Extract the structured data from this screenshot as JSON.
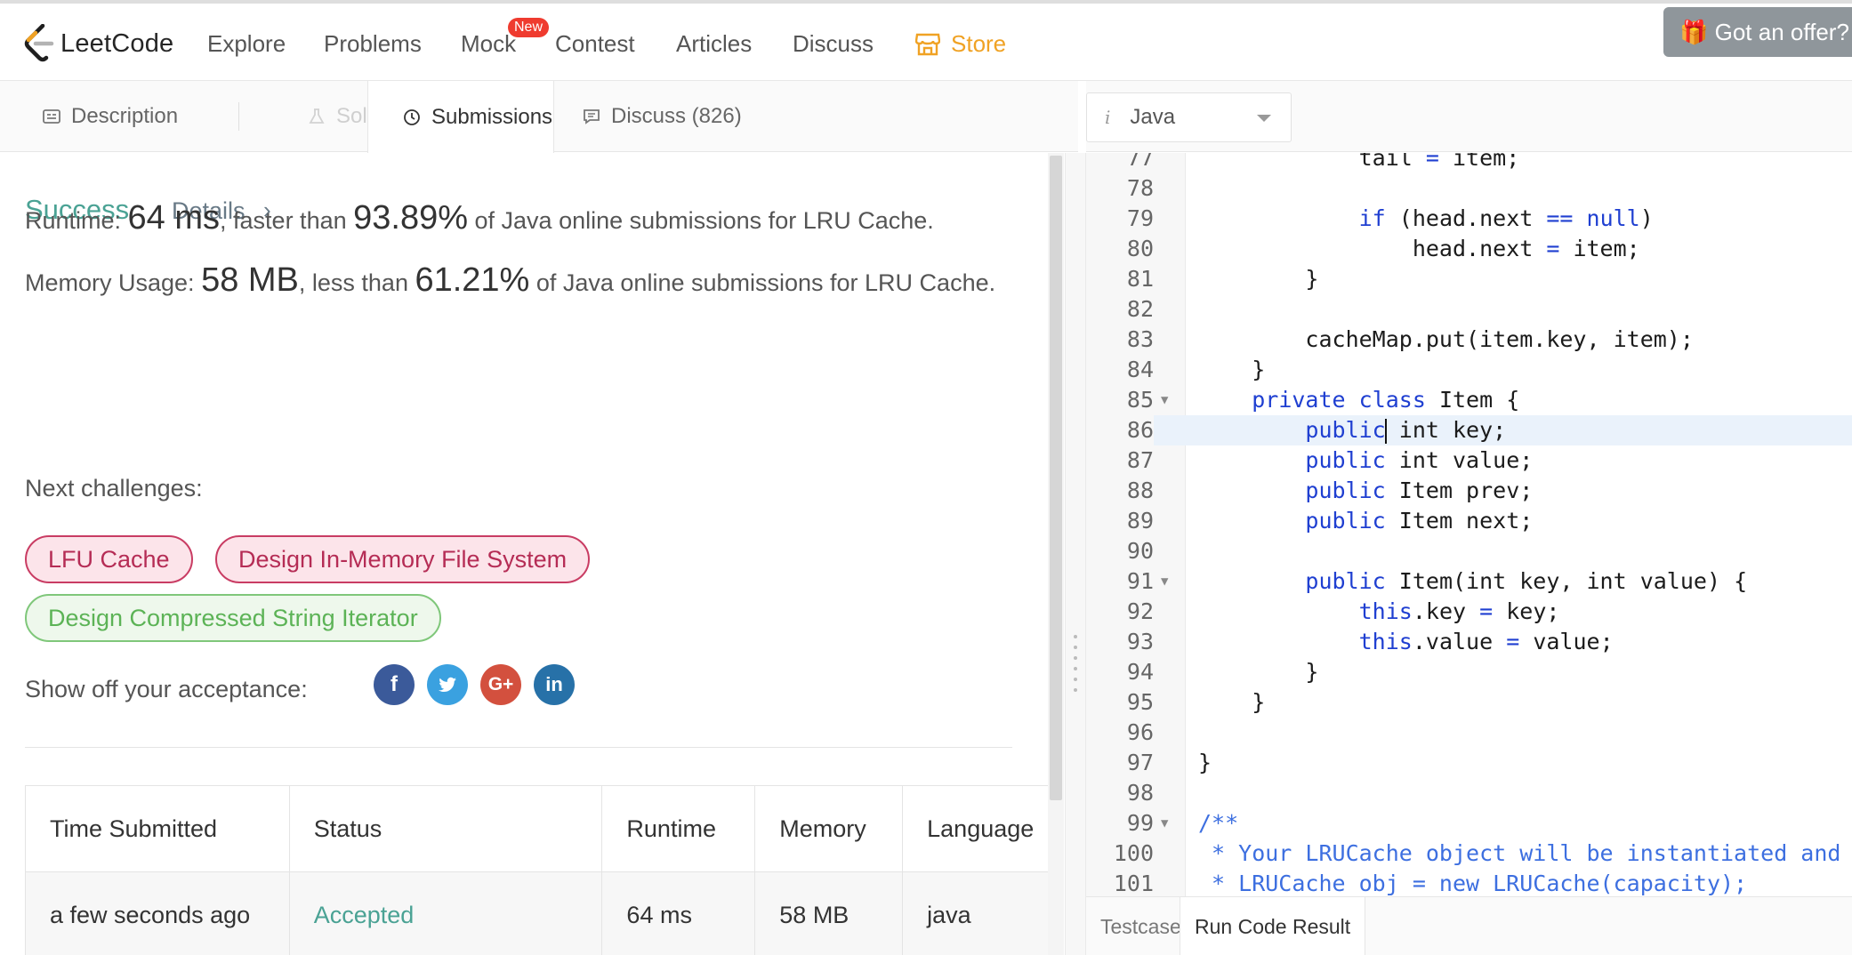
{
  "nav": {
    "logo_text": "LeetCode",
    "items": [
      "Explore",
      "Problems",
      "Mock",
      "Contest",
      "Articles",
      "Discuss"
    ],
    "mock_badge": "New",
    "store": "Store",
    "offer": "Got an offer?"
  },
  "tabs": {
    "description": "Description",
    "solution": "Solution",
    "submissions": "Submissions",
    "discuss": "Discuss (826)"
  },
  "result": {
    "status": "Success",
    "details": "Details",
    "details_chevron": "›",
    "runtime_label": "Runtime: ",
    "runtime_value": "64 ms",
    "runtime_mid": ", faster than ",
    "runtime_pct": "93.89%",
    "runtime_tail": " of Java online submissions for LRU Cache.",
    "memory_label": "Memory Usage: ",
    "memory_value": "58 MB",
    "memory_mid": ", less than ",
    "memory_pct": "61.21%",
    "memory_tail": " of Java online submissions for LRU Cache.",
    "next_challenges_label": "Next challenges:",
    "challenges": [
      {
        "label": "LFU Cache",
        "difficulty": "hard"
      },
      {
        "label": "Design In-Memory File System",
        "difficulty": "hard"
      },
      {
        "label": "Design Compressed String Iterator",
        "difficulty": "easy"
      }
    ],
    "show_off_label": "Show off your acceptance:",
    "social": [
      {
        "name": "facebook-icon",
        "glyph": "f",
        "color": "#3b5a9a"
      },
      {
        "name": "twitter-icon",
        "glyph": "🐦",
        "color": "#3aa1e0"
      },
      {
        "name": "google-plus-icon",
        "glyph": "G+",
        "color": "#d3503e"
      },
      {
        "name": "linkedin-icon",
        "glyph": "in",
        "color": "#2771a8"
      }
    ]
  },
  "submissions_table": {
    "headers": [
      "Time Submitted",
      "Status",
      "Runtime",
      "Memory",
      "Language"
    ],
    "rows": [
      [
        "a few seconds ago",
        "Accepted",
        "64 ms",
        "58 MB",
        "java"
      ]
    ]
  },
  "editor": {
    "language": "Java",
    "language_icon": "i",
    "first_line": 77,
    "lines": [
      {
        "n": "77",
        "code": "            tail = item;"
      },
      {
        "n": "78",
        "code": ""
      },
      {
        "n": "79",
        "code": "            if (head.next == null)"
      },
      {
        "n": "80",
        "code": "                head.next = item;"
      },
      {
        "n": "81",
        "code": "        }"
      },
      {
        "n": "82",
        "code": ""
      },
      {
        "n": "83",
        "code": "        cacheMap.put(item.key, item);"
      },
      {
        "n": "84",
        "code": "    }"
      },
      {
        "n": "85",
        "code": "    private class Item {",
        "fold": true
      },
      {
        "n": "86",
        "code": "        public int key;",
        "active": true
      },
      {
        "n": "87",
        "code": "        public int value;"
      },
      {
        "n": "88",
        "code": "        public Item prev;"
      },
      {
        "n": "89",
        "code": "        public Item next;"
      },
      {
        "n": "90",
        "code": ""
      },
      {
        "n": "91",
        "code": "        public Item(int key, int value) {",
        "fold": true
      },
      {
        "n": "92",
        "code": "            this.key = key;"
      },
      {
        "n": "93",
        "code": "            this.value = value;"
      },
      {
        "n": "94",
        "code": "        }"
      },
      {
        "n": "95",
        "code": "    }"
      },
      {
        "n": "96",
        "code": ""
      },
      {
        "n": "97",
        "code": "}"
      },
      {
        "n": "98",
        "code": ""
      },
      {
        "n": "99",
        "code": "/**",
        "fold": true
      },
      {
        "n": "100",
        "code": " * Your LRUCache object will be instantiated and called as such:"
      },
      {
        "n": "101",
        "code": " * LRUCache obj = new LRUCache(capacity);"
      }
    ]
  },
  "bottom_tabs": {
    "testcase": "Testcase",
    "run_code_result": "Run Code Result"
  },
  "colors": {
    "accent_green": "#4aa294",
    "store_orange": "#f0a224",
    "hard_border": "#c93c63",
    "easy_border": "#7fc77a",
    "keyword_blue": "#1f3fd1"
  }
}
